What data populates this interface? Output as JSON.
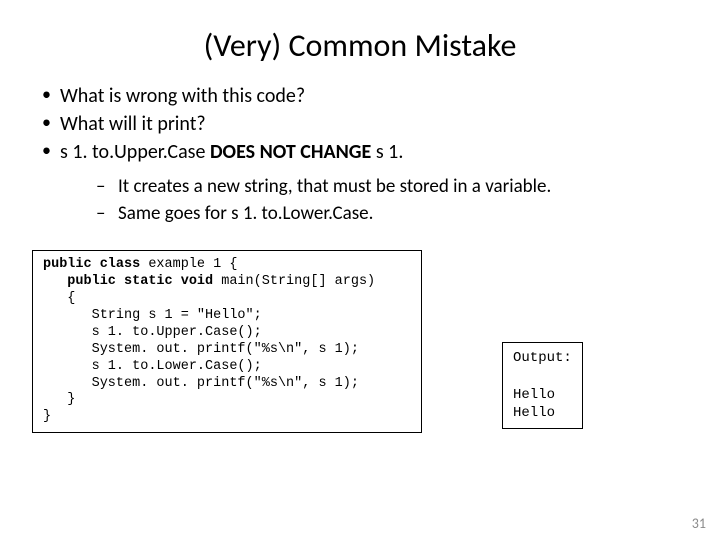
{
  "title": "(Very) Common Mistake",
  "bullets": {
    "b1": "What is wrong with this code?",
    "b2": "What will it print?",
    "b3_pre": "s 1. to.Upper.Case ",
    "b3_bold": "DOES NOT CHANGE",
    "b3_post": " s 1."
  },
  "sub": {
    "s1": " It creates a new string, that must be stored in a variable.",
    "s2": "Same goes for s 1. to.Lower.Case."
  },
  "code": {
    "l1a": "public class ",
    "l1b": "example 1 {",
    "l2a": "   public static void ",
    "l2b": "main(String[] args)",
    "l3": "   {",
    "l4": "      String s 1 = \"Hello\";",
    "l5": "      s 1. to.Upper.Case();",
    "l6": "      System. out. printf(\"%s\\n\", s 1);",
    "l7": "      s 1. to.Lower.Case();",
    "l8": "      System. out. printf(\"%s\\n\", s 1);",
    "l9": "   }",
    "l10": "}"
  },
  "output": {
    "label": "Output:",
    "line1": "Hello",
    "line2": "Hello"
  },
  "pagenum": "31"
}
